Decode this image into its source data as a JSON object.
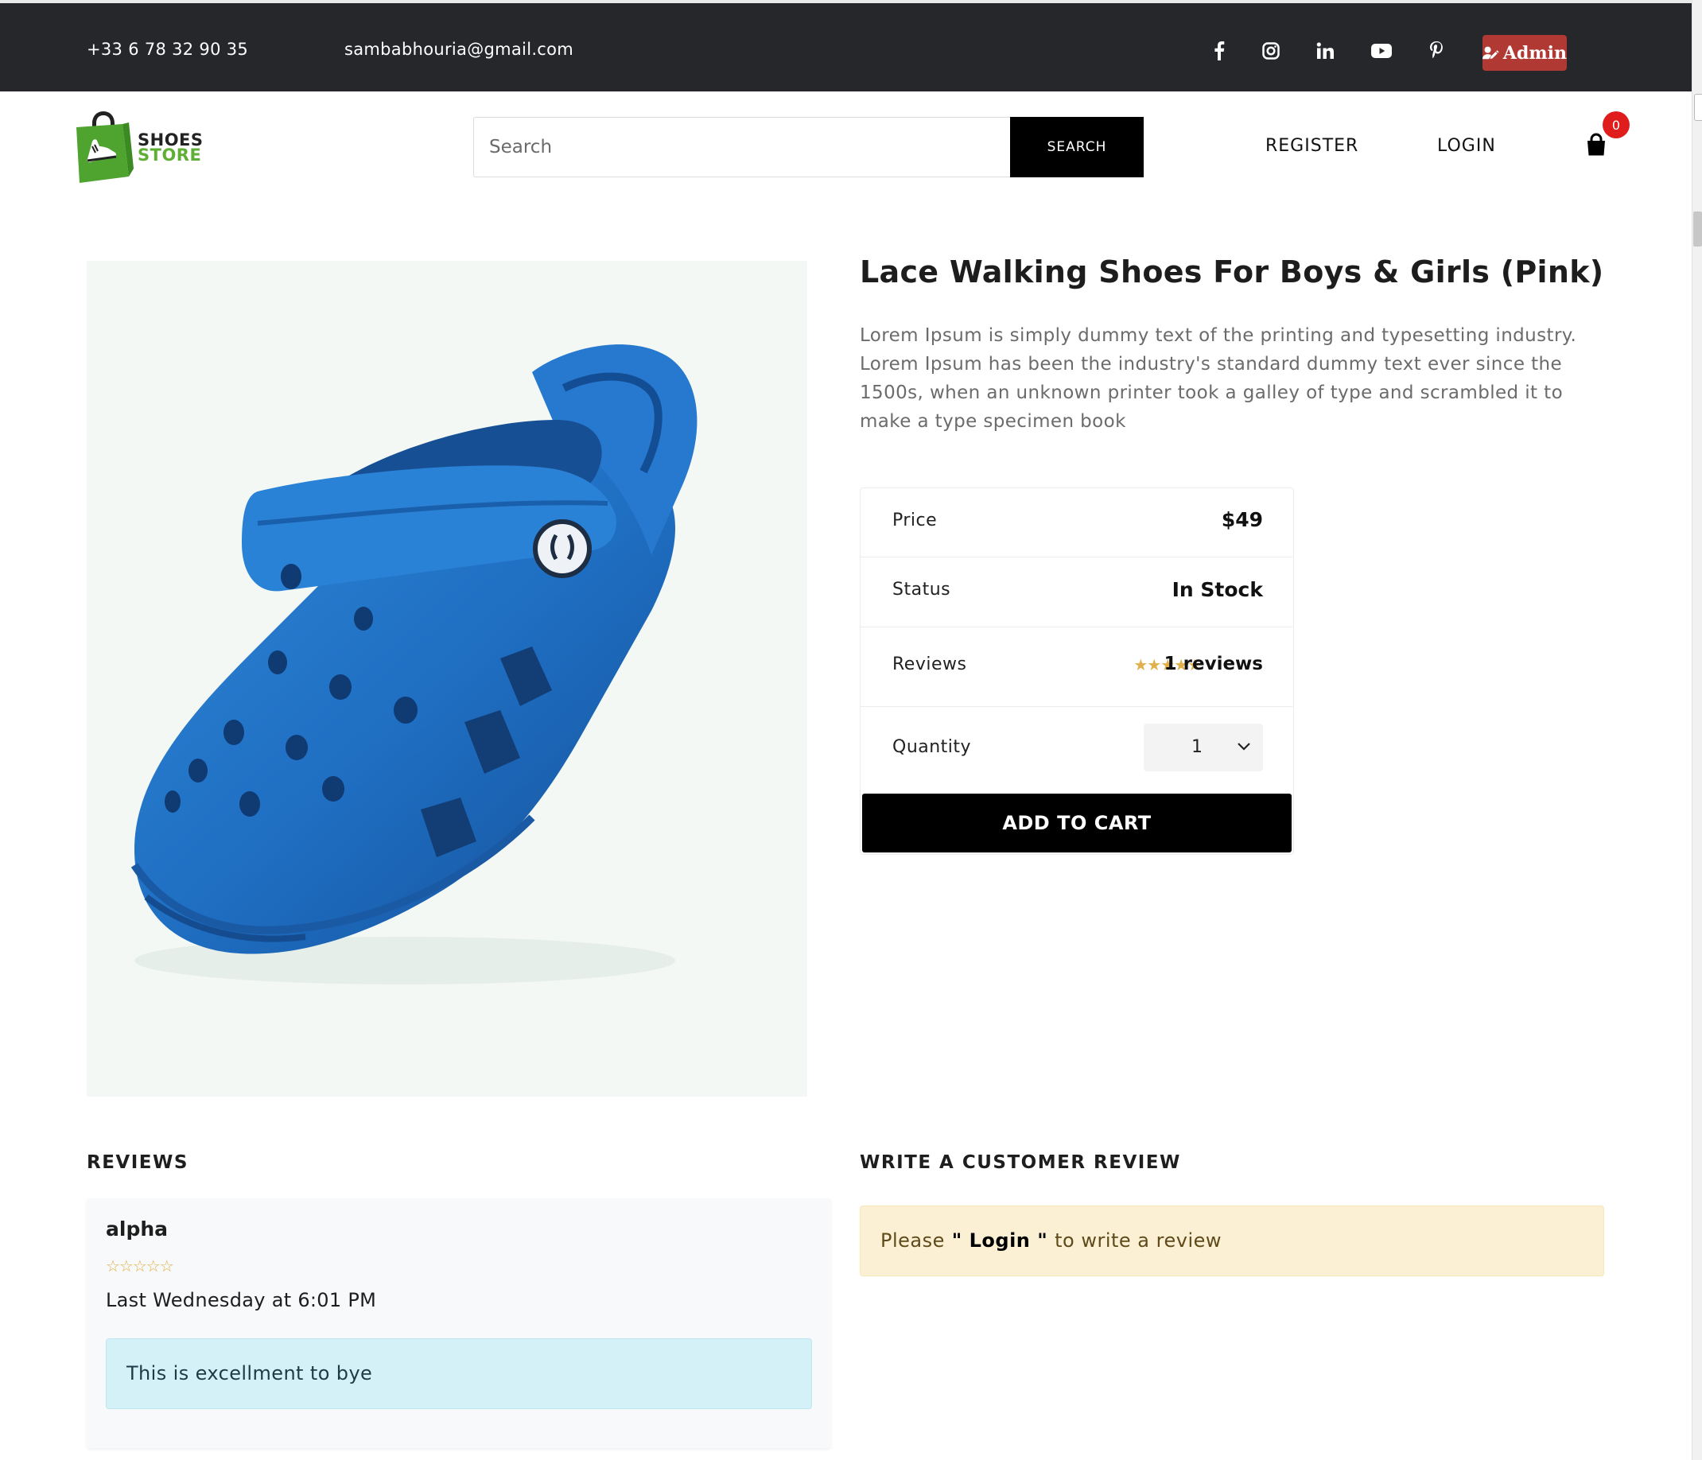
{
  "topbar": {
    "phone": "+33 6 78 32 90 35",
    "email": "sambabhouria@gmail.com",
    "social_icons": [
      "facebook-icon",
      "instagram-icon",
      "linkedin-icon",
      "youtube-icon",
      "pinterest-icon"
    ],
    "admin_label": "Admin",
    "bg_color": "#25272b",
    "admin_color": "#b03a33"
  },
  "header": {
    "logo_line1": "SHOES",
    "logo_line2": "STORE",
    "search_placeholder": "Search",
    "search_button": "SEARCH",
    "register": "REGISTER",
    "login": "LOGIN",
    "cart_count": "0"
  },
  "product": {
    "title": "Lace Walking Shoes For Boys & Girls (Pink)",
    "description": "Lorem Ipsum is simply dummy text of the printing and typesetting industry. Lorem Ipsum has been the industry's standard dummy text ever since the 1500s, when an unknown printer took a galley of type and scrambled it to make a type specimen book",
    "price_label": "Price",
    "price": "$49",
    "status_label": "Status",
    "status": "In Stock",
    "reviews_label": "Reviews",
    "rating": 5,
    "reviews_count": "1 reviews",
    "quantity_label": "Quantity",
    "quantity": "1",
    "add_to_cart": "ADD TO CART"
  },
  "reviews": {
    "heading": "REVIEWS",
    "items": [
      {
        "name": "alpha",
        "rating": 0,
        "date": "Last Wednesday at 6:01 PM",
        "comment": "This is excellment to bye"
      }
    ]
  },
  "write_review": {
    "heading": "WRITE A CUSTOMER REVIEW",
    "prefix": "Please",
    "quote_open": " \" ",
    "link": "Login",
    "quote_close": " \" ",
    "suffix": "to write a review"
  }
}
